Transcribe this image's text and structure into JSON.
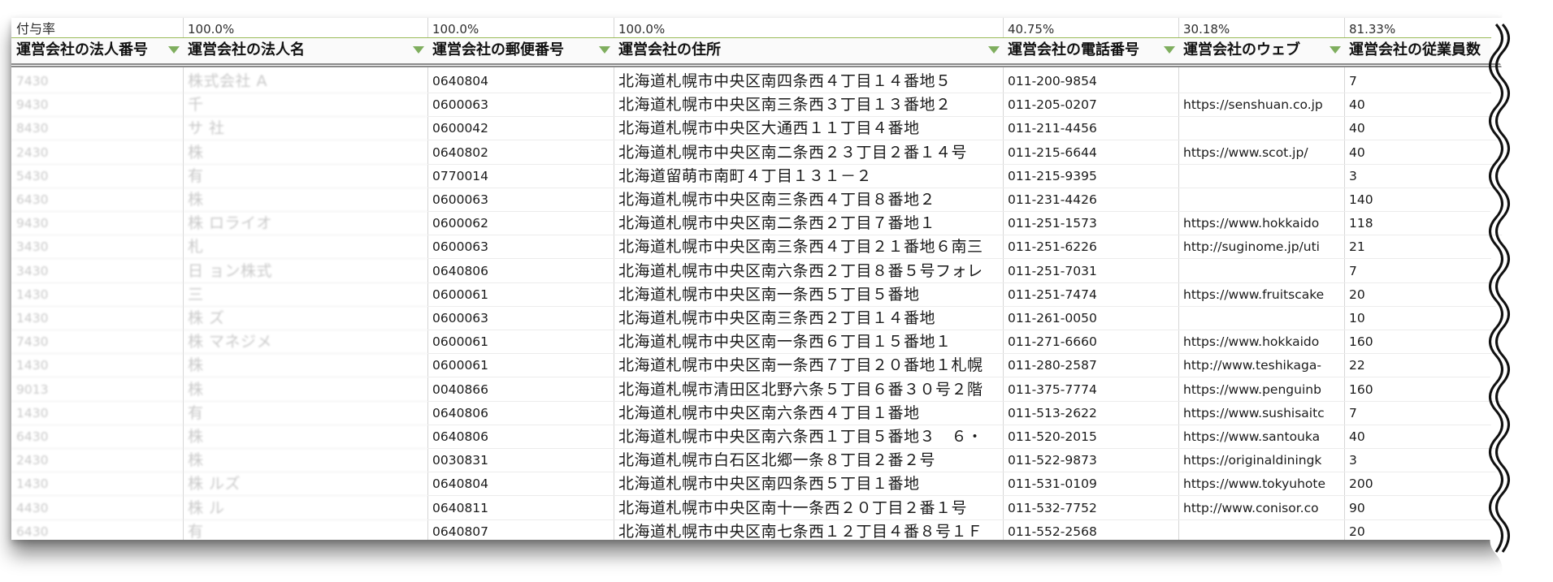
{
  "sheet": {
    "rate_label": "付与率",
    "rates": [
      "",
      "100.0%",
      "100.0%",
      "100.0%",
      "40.75%",
      "30.18%",
      "81.33%"
    ],
    "headers": [
      "運営会社の法人番号",
      "運営会社の法人名",
      "運営会社の郵便番号",
      "運営会社の住所",
      "運営会社の電話番号",
      "運営会社のウェブ",
      "運営会社の従業員数"
    ],
    "rows": [
      {
        "corp_no": "7430",
        "name": "株式会社  A",
        "postal": "0640804",
        "address": "北海道札幌市中央区南四条西４丁目１４番地５",
        "phone": "011-200-9854",
        "web": "",
        "employees": "7"
      },
      {
        "corp_no": "9430",
        "name": "千",
        "postal": "0600063",
        "address": "北海道札幌市中央区南三条西３丁目１３番地２",
        "phone": "011-205-0207",
        "web": "https://senshuan.co.jp",
        "employees": "40"
      },
      {
        "corp_no": "8430",
        "name": "サ  社",
        "postal": "0600042",
        "address": "北海道札幌市中央区大通西１１丁目４番地",
        "phone": "011-211-4456",
        "web": "",
        "employees": "40"
      },
      {
        "corp_no": "2430",
        "name": "株",
        "postal": "0640802",
        "address": "北海道札幌市中央区南二条西２３丁目２番１４号",
        "phone": "011-215-6644",
        "web": "https://www.scot.jp/",
        "employees": "40"
      },
      {
        "corp_no": "5430",
        "name": "有",
        "postal": "0770014",
        "address": "北海道留萌市南町４丁目１３１－２",
        "phone": "011-215-9395",
        "web": "",
        "employees": "3"
      },
      {
        "corp_no": "6430",
        "name": "株",
        "postal": "0600063",
        "address": "北海道札幌市中央区南三条西４丁目８番地２",
        "phone": "011-231-4426",
        "web": "",
        "employees": "140"
      },
      {
        "corp_no": "9430",
        "name": "株  ロライオ",
        "postal": "0600062",
        "address": "北海道札幌市中央区南二条西２丁目７番地１",
        "phone": "011-251-1573",
        "web": "https://www.hokkaido",
        "employees": "118"
      },
      {
        "corp_no": "3430",
        "name": "札",
        "postal": "0600063",
        "address": "北海道札幌市中央区南三条西４丁目２１番地６南三",
        "phone": "011-251-6226",
        "web": "http://suginome.jp/uti",
        "employees": "21"
      },
      {
        "corp_no": "3430",
        "name": "日  ョン株式",
        "postal": "0640806",
        "address": "北海道札幌市中央区南六条西２丁目８番５号フォレ",
        "phone": "011-251-7031",
        "web": "",
        "employees": "7"
      },
      {
        "corp_no": "1430",
        "name": "三",
        "postal": "0600061",
        "address": "北海道札幌市中央区南一条西５丁目５番地",
        "phone": "011-251-7474",
        "web": "https://www.fruitscake",
        "employees": "20"
      },
      {
        "corp_no": "1430",
        "name": "株  ズ",
        "postal": "0600063",
        "address": "北海道札幌市中央区南三条西２丁目１４番地",
        "phone": "011-261-0050",
        "web": "",
        "employees": "10"
      },
      {
        "corp_no": "7430",
        "name": "株  マネジメ",
        "postal": "0600061",
        "address": "北海道札幌市中央区南一条西６丁目１５番地１",
        "phone": "011-271-6660",
        "web": "https://www.hokkaido",
        "employees": "160"
      },
      {
        "corp_no": "1430",
        "name": "株",
        "postal": "0600061",
        "address": "北海道札幌市中央区南一条西７丁目２０番地１札幌",
        "phone": "011-280-2587",
        "web": "http://www.teshikaga-",
        "employees": "22"
      },
      {
        "corp_no": "9013",
        "name": "株",
        "postal": "0040866",
        "address": "北海道札幌市清田区北野六条５丁目６番３０号２階",
        "phone": "011-375-7774",
        "web": "https://www.penguinb",
        "employees": "160"
      },
      {
        "corp_no": "1430",
        "name": "有",
        "postal": "0640806",
        "address": "北海道札幌市中央区南六条西４丁目１番地",
        "phone": "011-513-2622",
        "web": "https://www.sushisaitc",
        "employees": "7"
      },
      {
        "corp_no": "6430",
        "name": "株",
        "postal": "0640806",
        "address": "北海道札幌市中央区南六条西１丁目５番地３　６・",
        "phone": "011-520-2015",
        "web": "https://www.santouka",
        "employees": "40"
      },
      {
        "corp_no": "2430",
        "name": "株",
        "postal": "0030831",
        "address": "北海道札幌市白石区北郷一条８丁目２番２号",
        "phone": "011-522-9873",
        "web": "https://originaldiningk",
        "employees": "3"
      },
      {
        "corp_no": "1430",
        "name": "株  ルズ",
        "postal": "0640804",
        "address": "北海道札幌市中央区南四条西５丁目１番地",
        "phone": "011-531-0109",
        "web": "https://www.tokyuhote",
        "employees": "200"
      },
      {
        "corp_no": "4430",
        "name": "株  ル",
        "postal": "0640811",
        "address": "北海道札幌市中央区南十一条西２０丁目２番１号",
        "phone": "011-532-7752",
        "web": "http://www.conisor.co",
        "employees": "90"
      },
      {
        "corp_no": "6430",
        "name": "有",
        "postal": "0640807",
        "address": "北海道札幌市中央区南七条西１２丁目４番８号１Ｆ",
        "phone": "011-552-2568",
        "web": "",
        "employees": "20"
      }
    ]
  },
  "colors": {
    "header_rule": "#9bbb59",
    "filter_icon": "#7fae5e",
    "gridline": "#d6d6d6"
  }
}
